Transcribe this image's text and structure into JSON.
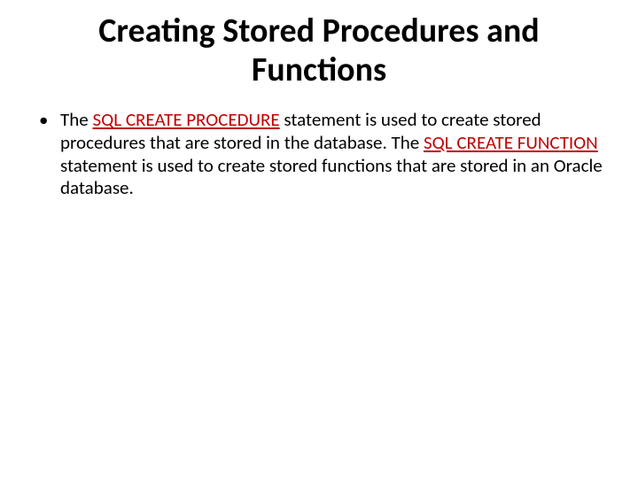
{
  "title": "Creating Stored Procedures and Functions",
  "bullet": {
    "pre1": "The ",
    "kw1": "SQL CREATE PROCEDURE",
    "mid1": " statement is used to create stored procedures that are stored in the database. The ",
    "kw2": "SQL CREATE FUNCTION",
    "post1": " statement is used to create stored functions that are stored in an Oracle database."
  },
  "colors": {
    "keyword": "#c00000",
    "text": "#000000",
    "background": "#ffffff"
  }
}
